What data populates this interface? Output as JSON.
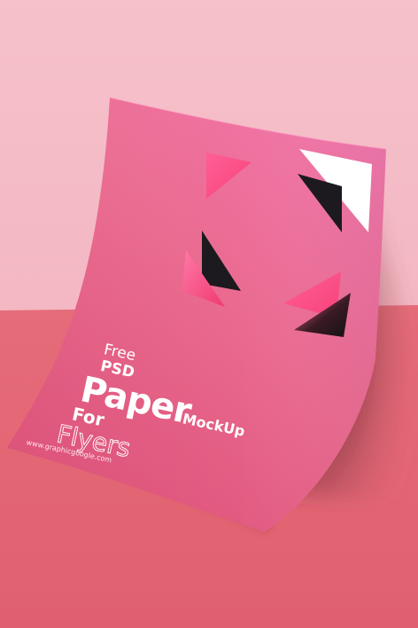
{
  "flyer": {
    "line_free": "Free",
    "line_psd": "PSD",
    "line_paper": "Paper",
    "line_for": "For",
    "line_flyers": "Flyers",
    "line_mockup": "MockUp",
    "website": "www.graphicgoogle.com"
  },
  "colors": {
    "wall": "#f3b8c2",
    "floor": "#e46876",
    "paper_light": "#f377ae",
    "paper_dark": "#d4436a",
    "shape_black": "#1c1a1e",
    "shape_white": "#ffffff",
    "shape_pink": "#ff5f8f"
  }
}
